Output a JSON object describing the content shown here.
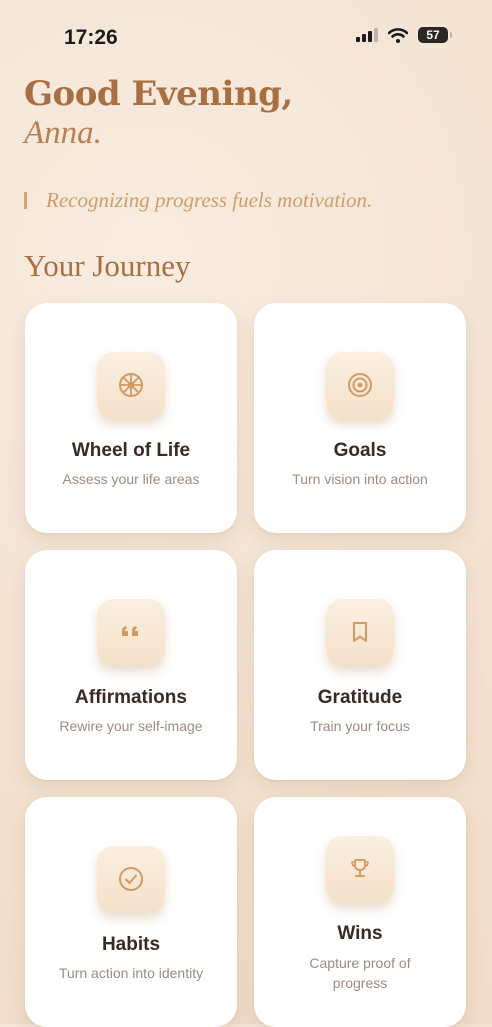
{
  "status_bar": {
    "time": "17:26",
    "battery": "57"
  },
  "header": {
    "greeting": "Good Evening,",
    "name": "Anna.",
    "quote": "Recognizing progress fuels motivation."
  },
  "section_title": "Your Journey",
  "cards": [
    {
      "title": "Wheel of Life",
      "subtitle": "Assess your life areas",
      "icon": "wheel-icon"
    },
    {
      "title": "Goals",
      "subtitle": "Turn vision into action",
      "icon": "target-icon"
    },
    {
      "title": "Affirmations",
      "subtitle": "Rewire your self-image",
      "icon": "quote-icon"
    },
    {
      "title": "Gratitude",
      "subtitle": "Train your focus",
      "icon": "bookmark-icon"
    },
    {
      "title": "Habits",
      "subtitle": "Turn action into identity",
      "icon": "check-circle-icon"
    },
    {
      "title": "Wins",
      "subtitle": "Capture proof of progress",
      "icon": "trophy-icon"
    }
  ],
  "colors": {
    "accent": "#a86f42",
    "icon": "#d19a63",
    "quote": "#d09c68"
  }
}
